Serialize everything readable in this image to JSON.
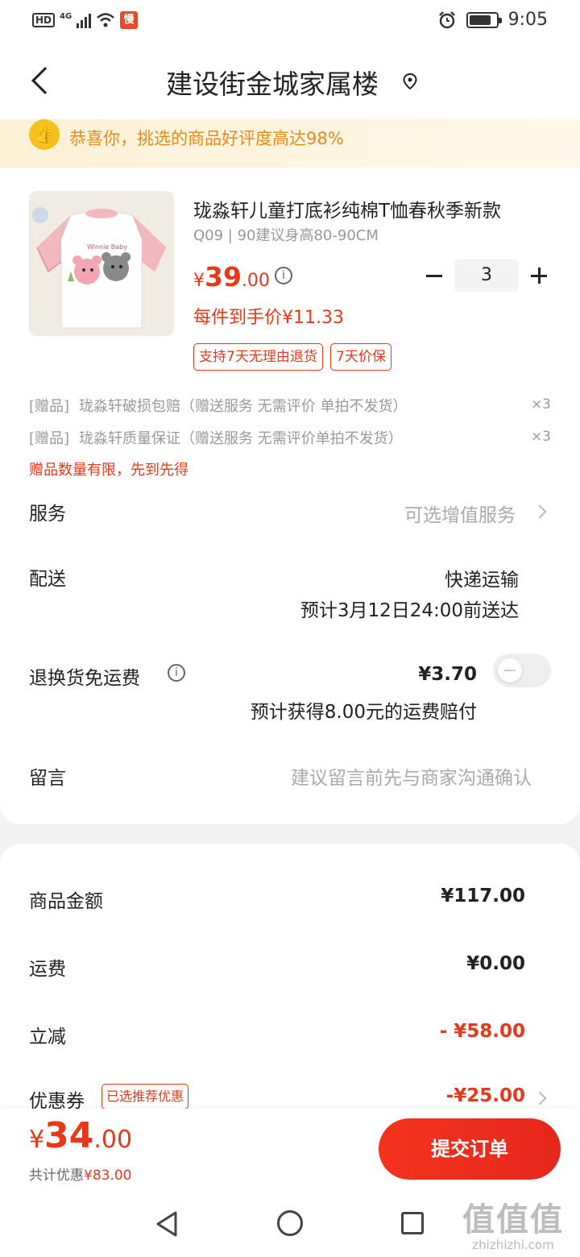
{
  "status_bar": {
    "hd": "HD",
    "network": "4G",
    "app_badge": "慢",
    "time": "9:05"
  },
  "header": {
    "title": "建设街金城家属楼"
  },
  "banner": {
    "text": "恭喜你，挑选的商品好评度高达98%"
  },
  "product": {
    "name": "珑淼轩儿童打底衫纯棉T恤春秋季新款",
    "spec": "Q09 | 90建议身高80-90CM",
    "price_currency": "¥",
    "price_int": "39",
    "price_dec": ".00",
    "quantity": "3",
    "unit_price": "每件到手价¥11.33",
    "tags": [
      "支持7天无理由退货",
      "7天价保"
    ],
    "image_shirt_text": "Winnie Baby"
  },
  "gifts": [
    {
      "label": "[赠品]",
      "text": "珑淼轩破损包赔（赠送服务 无需评价 单拍不发货）",
      "qty": "×3"
    },
    {
      "label": "[赠品]",
      "text": "珑淼轩质量保证（赠送服务 无需评价单拍不发货）",
      "qty": "×3"
    }
  ],
  "gift_warning": "赠品数量有限，先到先得",
  "service": {
    "label": "服务",
    "hint": "可选增值服务"
  },
  "delivery": {
    "label": "配送",
    "method": "快递运输",
    "eta": "预计3月12日24:00前送达"
  },
  "return_shipping": {
    "label": "退换货免运费",
    "price": "¥3.70",
    "desc": "预计获得8.00元的运费赔付",
    "enabled": false
  },
  "message": {
    "label": "留言",
    "placeholder": "建议留言前先与商家沟通确认"
  },
  "summary": {
    "goods_label": "商品金额",
    "goods_value": "¥117.00",
    "shipping_label": "运费",
    "shipping_value": "¥0.00",
    "discount_label": "立减",
    "discount_value": "- ¥58.00",
    "coupon_label": "优惠券",
    "coupon_tag": "已选推荐优惠",
    "coupon_value": "-¥25.00"
  },
  "bottom": {
    "total_currency": "¥",
    "total_int": "34",
    "total_dec": ".00",
    "saved_prefix": "共计优惠",
    "saved_value": "¥83.00",
    "submit_label": "提交订单"
  },
  "watermark": {
    "logo": "值值值",
    "url": "zhizhizhi.com"
  },
  "colors": {
    "accent": "#e8381a",
    "banner_text": "#e78b1a",
    "thumb_icon": "#f6c01d"
  }
}
